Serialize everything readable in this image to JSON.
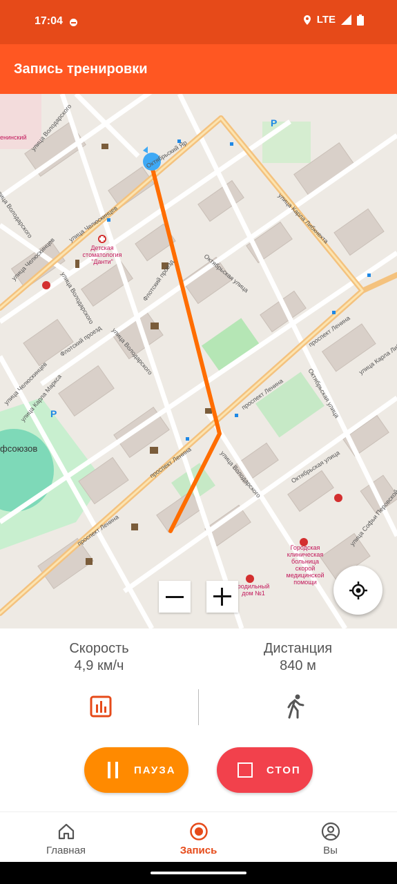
{
  "status_bar": {
    "time": "17:04",
    "network": "LTE"
  },
  "app_bar": {
    "title": "Запись тренировки"
  },
  "map": {
    "labels": {
      "street_chelyuskintsev_1": "улица Челюскинцев",
      "street_chelyuskintsev_2": "улица Челюскинцев",
      "street_volodarskogo_1": "улица Володарского",
      "street_volodarskogo_2": "улица Володарского",
      "street_volodarskogo_3": "улица Володарского",
      "street_volodarskogo_4": "улица Володарского",
      "street_volodarskogo_5": "улица Володарского",
      "oktyabrsky_yar": "Октябрьский Яр",
      "karla_libknekhta": "улица Карла Либкнехта",
      "oktyabrskaya_1": "Октябрьская улица",
      "oktyabrskaya_2": "Октябрьская улица",
      "oktyabrskaya_3": "Октябрьская улица",
      "flotsky_1": "Флотский проезд",
      "flotsky_2": "Флотский проезд",
      "lenina_1": "проспект Ленина",
      "lenina_2": "проспект Ленина",
      "lenina_3": "проспект Ленина",
      "lenina_4": "проспект Ленина",
      "karla_marksa": "улица Карла Маркса",
      "sofyi_perovskoy": "улица Софьи Перовской",
      "dental": "Детская стоматология \"Данти\"",
      "hospital": "Городская клиническая больница скорой медицинской помощи",
      "maternity": "родильный дом №1",
      "profsoyuzov": "фсоюзов",
      "leninsky": "енинский",
      "chelyuskintsev_small": "улица Челюскинцев"
    }
  },
  "route": {
    "color": "#FF6D00"
  },
  "zoom": {
    "out_icon": "minus-icon",
    "in_icon": "plus-icon"
  },
  "stats": {
    "speed_label": "Скорость",
    "speed_value": "4,9 км/ч",
    "distance_label": "Дистанция",
    "distance_value": "840 м"
  },
  "buttons": {
    "pause_label": "ПАУЗА",
    "stop_label": "СТОП",
    "pause_color": "#FF8A00",
    "stop_color": "#F2414C"
  },
  "bottom_nav": {
    "items": [
      {
        "label": "Главная",
        "icon": "home-icon"
      },
      {
        "label": "Запись",
        "icon": "record-icon"
      },
      {
        "label": "Вы",
        "icon": "profile-icon"
      }
    ],
    "active_color": "#E64A19"
  },
  "colors": {
    "status_bar": "#E64A19",
    "app_bar": "#FF5722"
  }
}
